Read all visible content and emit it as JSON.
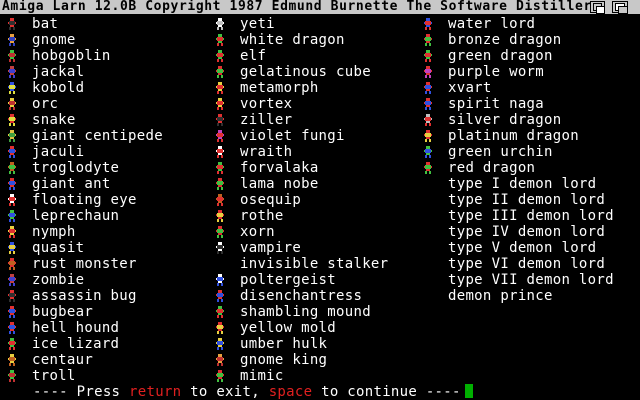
{
  "window": {
    "title": "Amiga Larn 12.0B Copyright 1987 Edmund Burnette  The Software Distillery"
  },
  "columns": [
    {
      "items": [
        {
          "name": "bat",
          "glyph": "bat-icon",
          "colors": [
            "#e03030",
            "#303030"
          ]
        },
        {
          "name": "gnome",
          "glyph": "gnome-icon",
          "colors": [
            "#e8a040",
            "#3040c0"
          ]
        },
        {
          "name": "hobgoblin",
          "glyph": "hobgoblin-icon",
          "colors": [
            "#40c040",
            "#c03030"
          ]
        },
        {
          "name": "jackal",
          "glyph": "jackal-icon",
          "colors": [
            "#c04040",
            "#4040d0"
          ]
        },
        {
          "name": "kobold",
          "glyph": "kobold-icon",
          "colors": [
            "#3050e0",
            "#e0e040"
          ]
        },
        {
          "name": "orc",
          "glyph": "orc-icon",
          "colors": [
            "#e8d040",
            "#c03030"
          ]
        },
        {
          "name": "snake",
          "glyph": "snake-icon",
          "colors": [
            "#e03030",
            "#e0e040"
          ]
        },
        {
          "name": "giant centipede",
          "glyph": "giant-centipede-icon",
          "colors": [
            "#e0c040",
            "#40a040"
          ]
        },
        {
          "name": "jaculi",
          "glyph": "jaculi-icon",
          "colors": [
            "#e03030",
            "#3050e0"
          ]
        },
        {
          "name": "troglodyte",
          "glyph": "troglodyte-icon",
          "colors": [
            "#c06020",
            "#40c040"
          ]
        },
        {
          "name": "giant ant",
          "glyph": "giant-ant-icon",
          "colors": [
            "#e03030",
            "#3050e0"
          ]
        },
        {
          "name": "floating eye",
          "glyph": "floating-eye-icon",
          "colors": [
            "#ffffff",
            "#e03030"
          ]
        },
        {
          "name": "leprechaun",
          "glyph": "leprechaun-icon",
          "colors": [
            "#40c040",
            "#3050e0"
          ]
        },
        {
          "name": "nymph",
          "glyph": "nymph-icon",
          "colors": [
            "#e8d040",
            "#e03030"
          ]
        },
        {
          "name": "quasit",
          "glyph": "quasit-icon",
          "colors": [
            "#3050e0",
            "#e8d040"
          ]
        },
        {
          "name": "rust monster",
          "glyph": "rust-monster-icon",
          "colors": [
            "#e03030",
            "#c06020"
          ]
        },
        {
          "name": "zombie",
          "glyph": "zombie-icon",
          "colors": [
            "#c04040",
            "#4040d0"
          ]
        },
        {
          "name": "assassin bug",
          "glyph": "assassin-bug-icon",
          "colors": [
            "#e03030",
            "#303030"
          ]
        },
        {
          "name": "bugbear",
          "glyph": "bugbear-icon",
          "colors": [
            "#e03030",
            "#3050e0"
          ]
        },
        {
          "name": "hell hound",
          "glyph": "hell-hound-icon",
          "colors": [
            "#e03030",
            "#3050e0"
          ]
        },
        {
          "name": "ice lizard",
          "glyph": "ice-lizard-icon",
          "colors": [
            "#40c040",
            "#e03030"
          ]
        },
        {
          "name": "centaur",
          "glyph": "centaur-icon",
          "colors": [
            "#e8d040",
            "#c06020"
          ]
        },
        {
          "name": "troll",
          "glyph": "troll-icon",
          "colors": [
            "#40c040",
            "#c03030"
          ]
        }
      ]
    },
    {
      "items": [
        {
          "name": "yeti",
          "glyph": "yeti-icon",
          "colors": [
            "#ffffff",
            "#c0c0c0"
          ]
        },
        {
          "name": "white dragon",
          "glyph": "white-dragon-icon",
          "colors": [
            "#40c040",
            "#e03030"
          ]
        },
        {
          "name": "elf",
          "glyph": "elf-icon",
          "colors": [
            "#40c040",
            "#e03030"
          ]
        },
        {
          "name": "gelatinous cube",
          "glyph": "gelatinous-cube-icon",
          "colors": [
            "#e03030",
            "#40c040"
          ]
        },
        {
          "name": "metamorph",
          "glyph": "metamorph-icon",
          "colors": [
            "#e8d040",
            "#e03030"
          ]
        },
        {
          "name": "vortex",
          "glyph": "vortex-icon",
          "colors": [
            "#e8d040",
            "#e03030"
          ]
        },
        {
          "name": "ziller",
          "glyph": "ziller-icon",
          "colors": [
            "#e03030",
            "#303030"
          ]
        },
        {
          "name": "violet fungi",
          "glyph": "violet-fungi-icon",
          "colors": [
            "#c040c0",
            "#e03030"
          ]
        },
        {
          "name": "wraith",
          "glyph": "wraith-icon",
          "colors": [
            "#ffffff",
            "#e03030"
          ]
        },
        {
          "name": "forvalaka",
          "glyph": "forvalaka-icon",
          "colors": [
            "#40c040",
            "#e03030"
          ]
        },
        {
          "name": "lama nobe",
          "glyph": "lama-nobe-icon",
          "colors": [
            "#e03030",
            "#40c040"
          ]
        },
        {
          "name": "osequip",
          "glyph": "osequip-icon",
          "colors": [
            "#c06020",
            "#e03030"
          ]
        },
        {
          "name": "rothe",
          "glyph": "rothe-icon",
          "colors": [
            "#e03030",
            "#e8d040"
          ]
        },
        {
          "name": "xorn",
          "glyph": "xorn-icon",
          "colors": [
            "#e03030",
            "#40c040"
          ]
        },
        {
          "name": "vampire",
          "glyph": "vampire-icon",
          "colors": [
            "#ffffff",
            "#303030"
          ]
        },
        {
          "name": "invisible stalker",
          "glyph": "none",
          "colors": []
        },
        {
          "name": "poltergeist",
          "glyph": "poltergeist-icon",
          "colors": [
            "#ffffff",
            "#3050e0"
          ]
        },
        {
          "name": "disenchantress",
          "glyph": "disenchantress-icon",
          "colors": [
            "#e03030",
            "#3050e0"
          ]
        },
        {
          "name": "shambling mound",
          "glyph": "shambling-mound-icon",
          "colors": [
            "#40c040",
            "#e03030"
          ]
        },
        {
          "name": "yellow mold",
          "glyph": "yellow-mold-icon",
          "colors": [
            "#e03030",
            "#e8d040"
          ]
        },
        {
          "name": "umber hulk",
          "glyph": "umber-hulk-icon",
          "colors": [
            "#e8d040",
            "#3050e0"
          ]
        },
        {
          "name": "gnome king",
          "glyph": "gnome-king-icon",
          "colors": [
            "#e8a040",
            "#c03030"
          ]
        },
        {
          "name": "mimic",
          "glyph": "mimic-icon",
          "colors": [
            "#e03030",
            "#40c040"
          ]
        }
      ]
    },
    {
      "items": [
        {
          "name": "water lord",
          "glyph": "water-lord-icon",
          "colors": [
            "#3050e0",
            "#e03030"
          ]
        },
        {
          "name": "bronze dragon",
          "glyph": "bronze-dragon-icon",
          "colors": [
            "#e03030",
            "#40c040"
          ]
        },
        {
          "name": "green dragon",
          "glyph": "green-dragon-icon",
          "colors": [
            "#40c040",
            "#e03030"
          ]
        },
        {
          "name": "purple worm",
          "glyph": "purple-worm-icon",
          "colors": [
            "#e03030",
            "#c040c0"
          ]
        },
        {
          "name": "xvart",
          "glyph": "xvart-icon",
          "colors": [
            "#e03030",
            "#3050e0"
          ]
        },
        {
          "name": "spirit naga",
          "glyph": "spirit-naga-icon",
          "colors": [
            "#e03030",
            "#3050e0"
          ]
        },
        {
          "name": "silver dragon",
          "glyph": "silver-dragon-icon",
          "colors": [
            "#c0c0c0",
            "#e03030"
          ]
        },
        {
          "name": "platinum dragon",
          "glyph": "platinum-dragon-icon",
          "colors": [
            "#e03030",
            "#e8d040"
          ]
        },
        {
          "name": "green urchin",
          "glyph": "green-urchin-icon",
          "colors": [
            "#40c040",
            "#3050e0"
          ]
        },
        {
          "name": "red dragon",
          "glyph": "red-dragon-icon",
          "colors": [
            "#e03030",
            "#40c040"
          ]
        },
        {
          "name": "type I demon lord",
          "glyph": "none",
          "colors": []
        },
        {
          "name": "type II demon lord",
          "glyph": "none",
          "colors": []
        },
        {
          "name": "type III demon lord",
          "glyph": "none",
          "colors": []
        },
        {
          "name": "type IV demon lord",
          "glyph": "none",
          "colors": []
        },
        {
          "name": "type V demon lord",
          "glyph": "none",
          "colors": []
        },
        {
          "name": "type VI demon lord",
          "glyph": "none",
          "colors": []
        },
        {
          "name": "type VII demon lord",
          "glyph": "none",
          "colors": []
        },
        {
          "name": "demon prince",
          "glyph": "none",
          "colors": []
        }
      ]
    }
  ],
  "footer": {
    "prefix": "---- Press ",
    "key1": "return",
    "middle": " to exit, ",
    "key2": "space",
    "suffix": " to continue ----"
  }
}
